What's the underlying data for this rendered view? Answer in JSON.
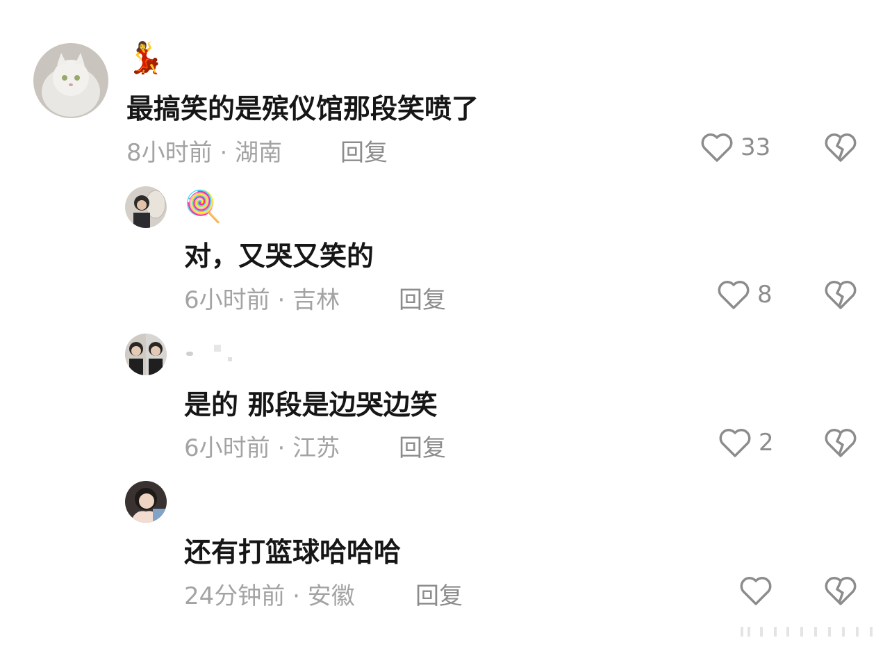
{
  "comments": [
    {
      "avatar": "cat-avatar",
      "username": "💃",
      "text": "最搞笑的是殡仪馆那段笑喷了",
      "time": "8小时前",
      "location": "湖南",
      "reply_label": "回复",
      "likes": "33"
    },
    {
      "avatar": "fairy-avatar",
      "username": "🍭",
      "text": "对，又哭又笑的",
      "time": "6小时前",
      "location": "吉林",
      "reply_label": "回复",
      "likes": "8"
    },
    {
      "avatar": "two-faces-avatar",
      "username": "",
      "text": "是的 那段是边哭边笑",
      "time": "6小时前",
      "location": "江苏",
      "reply_label": "回复",
      "likes": "2"
    },
    {
      "avatar": "girl-avatar",
      "username": "",
      "text": "还有打篮球哈哈哈",
      "time": "24分钟前",
      "location": "安徽",
      "reply_label": "回复",
      "likes": ""
    }
  ],
  "separator": "·",
  "icons": {
    "like": "heart-outline-icon",
    "dislike": "broken-heart-icon"
  },
  "colors": {
    "text": "#161616",
    "meta": "#a3a3a3",
    "icon": "#8c8c8c"
  }
}
